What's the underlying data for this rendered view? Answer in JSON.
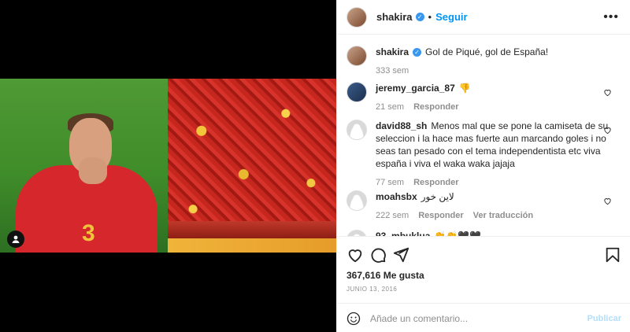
{
  "post": {
    "author": "shakira",
    "follow_label": "Seguir",
    "dot": "•",
    "more_icon": "more-horizontal-icon",
    "caption": "Gol de Piqué, gol de España!",
    "caption_age": "333 sem",
    "player_number": "3"
  },
  "comments": [
    {
      "user": "jeremy_garcia_87",
      "text": "👎",
      "age": "21 sem",
      "reply": "Responder",
      "extra": ""
    },
    {
      "user": "david88_sh",
      "text": "Menos mal que se pone la camiseta de su seleccion i la hace mas fuerte aun marcando goles i no seas tan pesado con el tema independentista etc viva españa i viva el waka waka jajaja",
      "age": "77 sem",
      "reply": "Responder",
      "extra": ""
    },
    {
      "user": "moahsbx",
      "text": "لاين خور",
      "age": "222 sem",
      "reply": "Responder",
      "extra": "Ver traducción"
    },
    {
      "user": "93_mbuklua",
      "text": "👏👏🖤🖤",
      "age": "",
      "reply": "",
      "extra": ""
    }
  ],
  "stats": {
    "likes": "367,616 Me gusta",
    "date": "JUNIO 13, 2016"
  },
  "composer": {
    "placeholder": "Añade un comentario...",
    "publish_label": "Publicar"
  },
  "colors": {
    "accent": "#0095f6",
    "publish_disabled": "#b2dffc",
    "muted": "#8e8e8e"
  }
}
